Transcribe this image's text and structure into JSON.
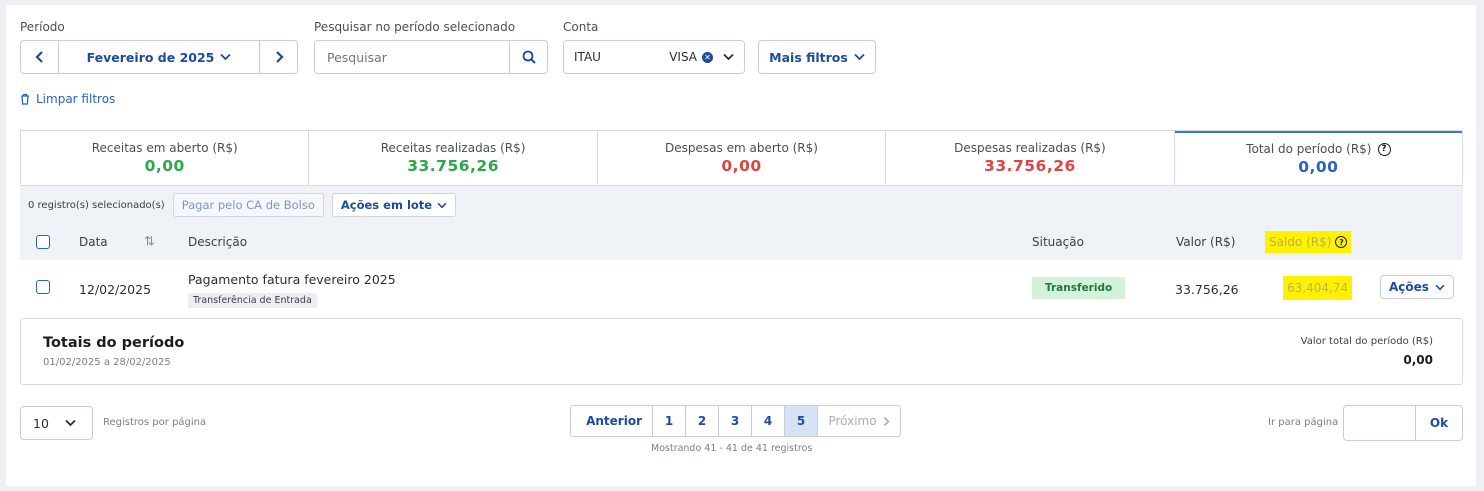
{
  "filters": {
    "period_label": "Período",
    "period_value": "Fevereiro de 2025",
    "search_label": "Pesquisar no período selecionado",
    "search_placeholder": "Pesquisar",
    "account_label": "Conta",
    "account_value": "ITAU",
    "account_card": "VISA",
    "more_filters": "Mais filtros",
    "clear_filters": "Limpar filtros"
  },
  "summary": [
    {
      "title": "Receitas em aberto (R$)",
      "value": "0,00",
      "color": "#2aa84a"
    },
    {
      "title": "Receitas realizadas (R$)",
      "value": "33.756,26",
      "color": "#2aa84a"
    },
    {
      "title": "Despesas em aberto (R$)",
      "value": "0,00",
      "color": "#e04343"
    },
    {
      "title": "Despesas realizadas (R$)",
      "value": "33.756,26",
      "color": "#e04343"
    },
    {
      "title": "Total do período (R$)",
      "value": "0,00",
      "color": "#2a63c6"
    }
  ],
  "toolbar": {
    "selected_count": "0 registro(s) selecionado(s)",
    "pay_button": "Pagar pelo CA de Bolso",
    "batch_actions": "Ações em lote"
  },
  "table": {
    "headers": {
      "date": "Data",
      "description": "Descrição",
      "status": "Situação",
      "amount": "Valor (R$)",
      "balance": "Saldo (R$)"
    },
    "rows": [
      {
        "date": "12/02/2025",
        "description": "Pagamento fatura fevereiro 2025",
        "tag": "Transferência de Entrada",
        "status": "Transferido",
        "amount": "33.756,26",
        "balance": "63.404,74",
        "actions": "Ações"
      }
    ]
  },
  "totals": {
    "title": "Totais do período",
    "range": "01/02/2025 a 28/02/2025",
    "total_label": "Valor total do período (R$)",
    "total_value": "0,00"
  },
  "pagination": {
    "per_page": "10",
    "per_page_label": "Registros por página",
    "prev": "Anterior",
    "next": "Próximo",
    "pages": [
      "1",
      "2",
      "3",
      "4",
      "5"
    ],
    "current_page": "5",
    "showing": "Mostrando 41 - 41 de 41 registros",
    "goto_label": "Ir para página",
    "ok": "Ok"
  }
}
